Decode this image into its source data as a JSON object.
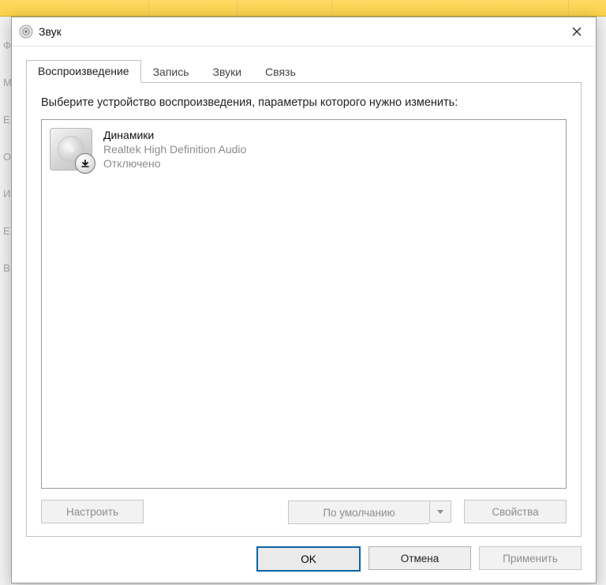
{
  "window": {
    "title": "Звук"
  },
  "tabs": [
    {
      "label": "Воспроизведение",
      "active": true
    },
    {
      "label": "Запись",
      "active": false
    },
    {
      "label": "Звуки",
      "active": false
    },
    {
      "label": "Связь",
      "active": false
    }
  ],
  "instruction": "Выберите устройство воспроизведения, параметры которого нужно изменить:",
  "devices": [
    {
      "name": "Динамики",
      "driver": "Realtek High Definition Audio",
      "status": "Отключено",
      "overlay": "down-arrow"
    }
  ],
  "panel_buttons": {
    "configure": "Настроить",
    "set_default": "По умолчанию",
    "properties": "Свойства"
  },
  "dialog_buttons": {
    "ok": "OK",
    "cancel": "Отмена",
    "apply": "Применить"
  },
  "bg_letters": [
    "Ф",
    "М",
    "Е",
    "О",
    "И",
    "Е",
    "В"
  ]
}
